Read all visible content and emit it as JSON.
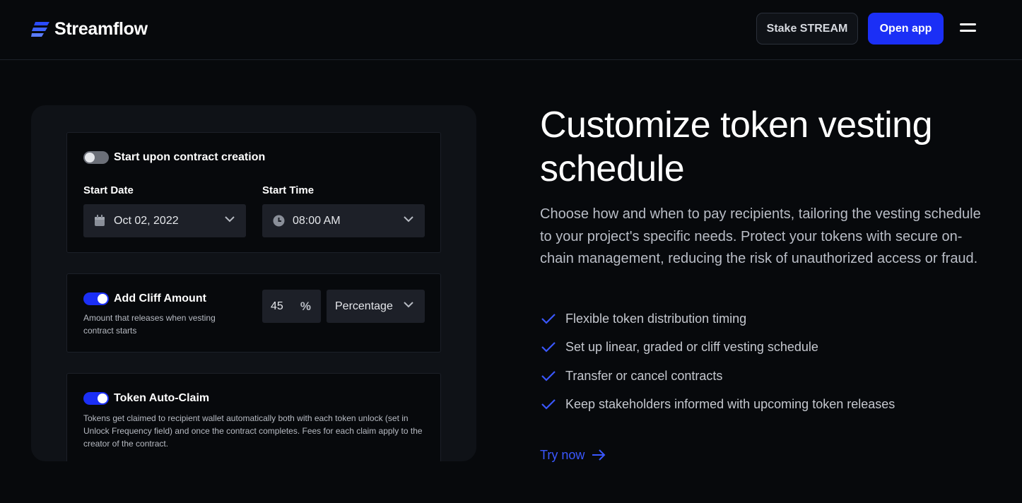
{
  "header": {
    "brand": "Streamflow",
    "stake_label": "Stake STREAM",
    "open_app_label": "Open app",
    "menu_icon": "hamburger-menu-icon"
  },
  "form": {
    "start_card": {
      "toggle_label": "Start upon contract creation",
      "toggle_on": false,
      "start_date_label": "Start Date",
      "start_date_value": "Oct 02, 2022",
      "start_time_label": "Start Time",
      "start_time_value": "08:00 AM"
    },
    "cliff_card": {
      "toggle_label": "Add Cliff Amount",
      "toggle_on": true,
      "description": "Amount that releases when vesting contract starts",
      "amount_value": "45",
      "unit_symbol": "%",
      "unit_select_value": "Percentage"
    },
    "autoclaim_card": {
      "toggle_label": "Token Auto-Claim",
      "toggle_on": true,
      "description": "Tokens get claimed to recipient wallet automatically both with each token unlock (set in Unlock Frequency field) and once the contract completes. Fees for each claim apply to the creator of the contract."
    }
  },
  "content": {
    "headline": "Customize token vesting schedule",
    "description": "Choose how and when to pay recipients, tailoring the vesting schedule to your project's specific needs. Protect your tokens with secure on-chain management, reducing the risk of unauthorized access or fraud.",
    "features": [
      "Flexible token distribution timing",
      "Set up linear, graded or cliff vesting schedule",
      "Transfer or cancel contracts",
      "Keep stakeholders informed with upcoming token releases"
    ],
    "cta_label": "Try now"
  },
  "colors": {
    "background": "#07090c",
    "panel": "#0f1217",
    "accent_blue": "#1b2ff6",
    "link_blue": "#3a57ff",
    "check_blue": "#3a57ff"
  }
}
